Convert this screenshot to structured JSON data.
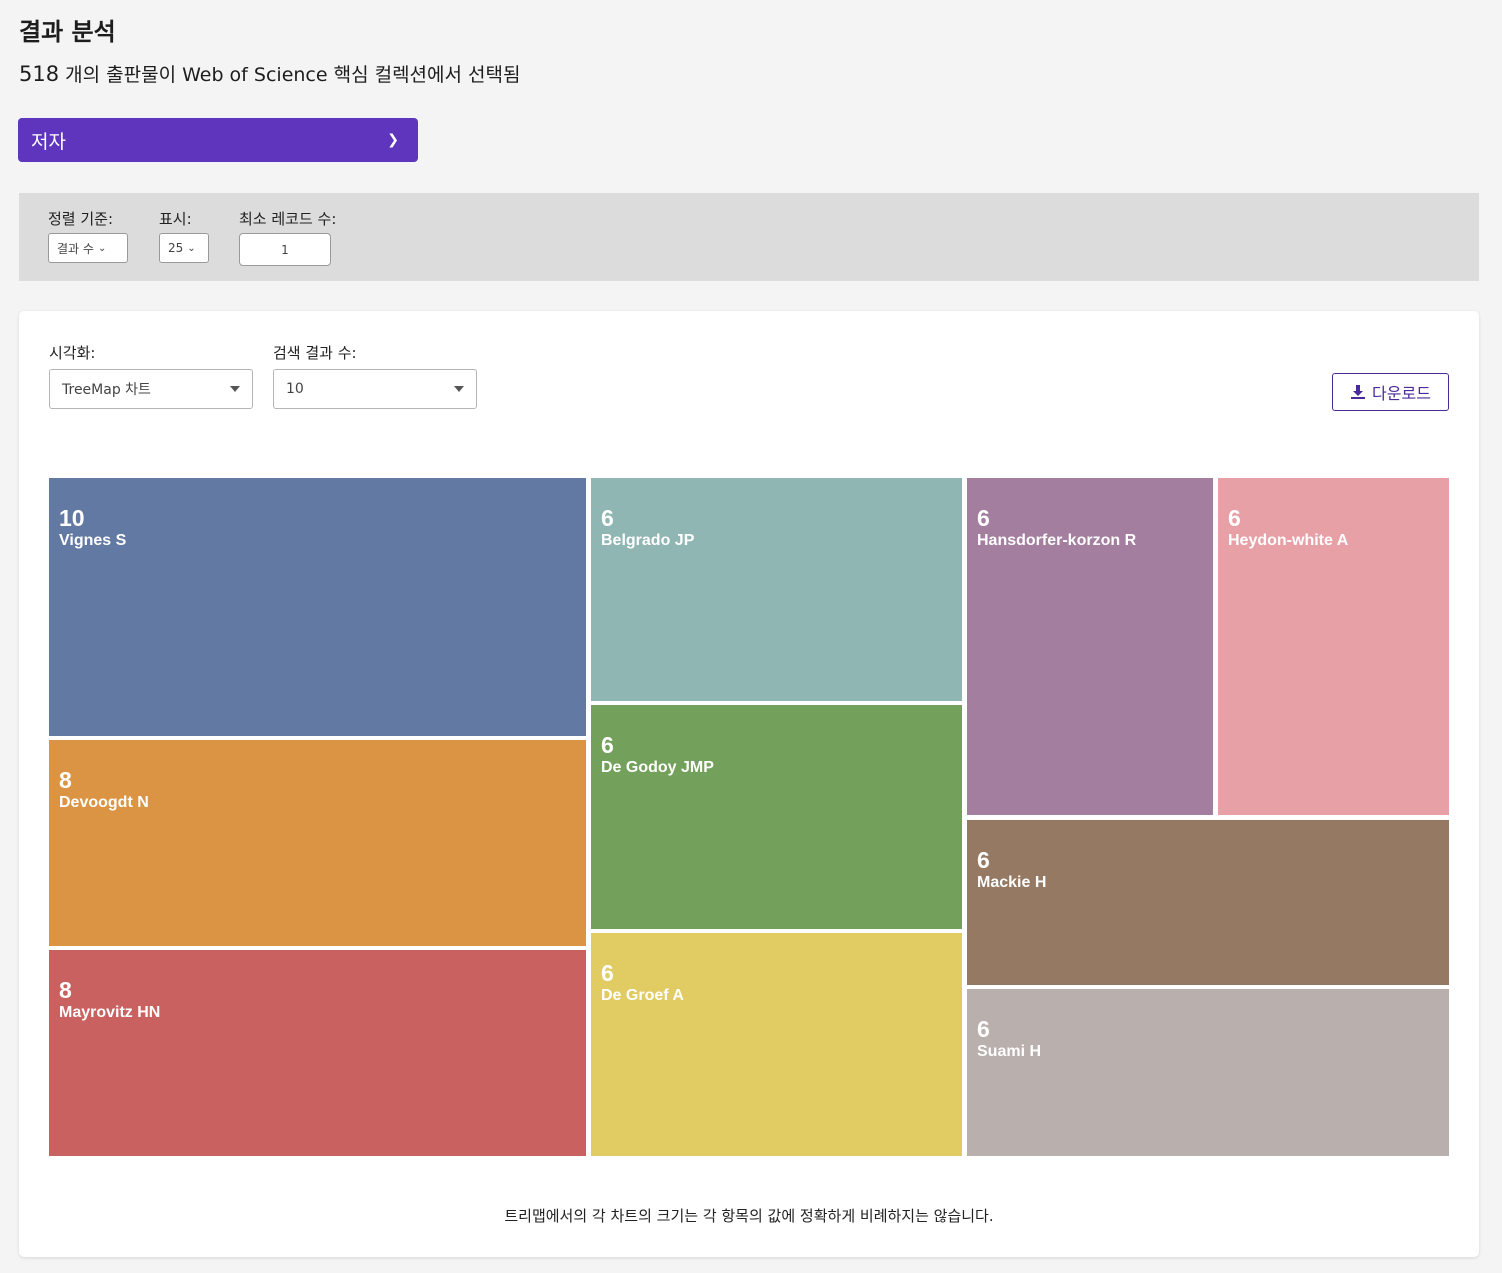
{
  "header": {
    "title": "결과 분석",
    "count": "518",
    "subtitle_text": " 개의 출판물이 Web of Science 핵심 컬렉션에서 선택됨"
  },
  "field_select": {
    "label": "저자",
    "icon": "chevron-down-icon"
  },
  "filters": {
    "sort_label": "정렬 기준:",
    "sort_value": "결과 수",
    "show_label": "표시:",
    "show_value": "25",
    "min_label": "최소 레코드 수:",
    "min_value": "1"
  },
  "visualization": {
    "viz_label": "시각화:",
    "viz_value": "TreeMap 차트",
    "count_label": "검색 결과 수:",
    "count_value": "10",
    "download_label": "다운로드",
    "download_icon": "download-icon"
  },
  "chart_data": {
    "type": "treemap",
    "items": [
      {
        "name": "Vignes S",
        "value": 10,
        "color": "#6279a4"
      },
      {
        "name": "Devoogdt N",
        "value": 8,
        "color": "#db9444"
      },
      {
        "name": "Mayrovitz HN",
        "value": 8,
        "color": "#c86160"
      },
      {
        "name": "Belgrado JP",
        "value": 6,
        "color": "#8fb6b2"
      },
      {
        "name": "De Godoy JMP",
        "value": 6,
        "color": "#73a05a"
      },
      {
        "name": "De Groef A",
        "value": 6,
        "color": "#e1cb63"
      },
      {
        "name": "Hansdorfer-korzon R",
        "value": 6,
        "color": "#a37e9f"
      },
      {
        "name": "Heydon-white A",
        "value": 6,
        "color": "#e8a0a7"
      },
      {
        "name": "Mackie H",
        "value": 6,
        "color": "#957963"
      },
      {
        "name": "Suami H",
        "value": 6,
        "color": "#b9afac"
      }
    ]
  },
  "footnote": "트리맵에서의 각 차트의 크기는 각 항목의 값에 정확하게 비례하지는 않습니다."
}
